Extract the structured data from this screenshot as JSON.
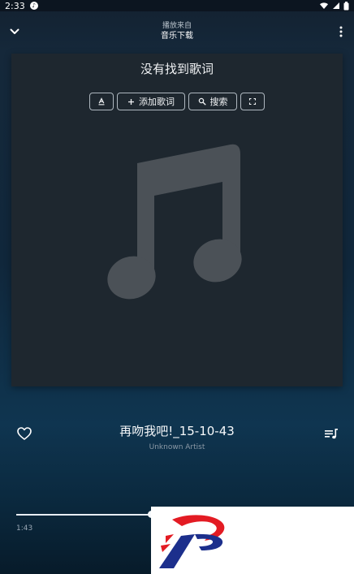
{
  "status_bar": {
    "time": "2:33",
    "app_icon": "music-note-icon"
  },
  "header": {
    "source_label": "播放来自",
    "source_name": "音乐下载",
    "collapse_icon": "chevron-down-icon",
    "more_icon": "more-vert-icon"
  },
  "lyrics": {
    "title": "没有找到歌词",
    "actions": [
      {
        "icon": "text-style-icon",
        "label": ""
      },
      {
        "icon": "plus-icon",
        "label": "添加歌词"
      },
      {
        "icon": "search-icon",
        "label": "搜索"
      },
      {
        "icon": "fullscreen-icon",
        "label": ""
      }
    ],
    "placeholder_icon": "music-note-icon"
  },
  "track": {
    "title": "再吻我吧!_15-10-43",
    "artist": "Unknown Artist"
  },
  "player": {
    "elapsed": "1:43",
    "progress": 0.42,
    "like_icon": "heart-outline-icon",
    "queue_icon": "queue-music-icon"
  },
  "overlay": {
    "logo_icon": "brand-logo-icon"
  }
}
